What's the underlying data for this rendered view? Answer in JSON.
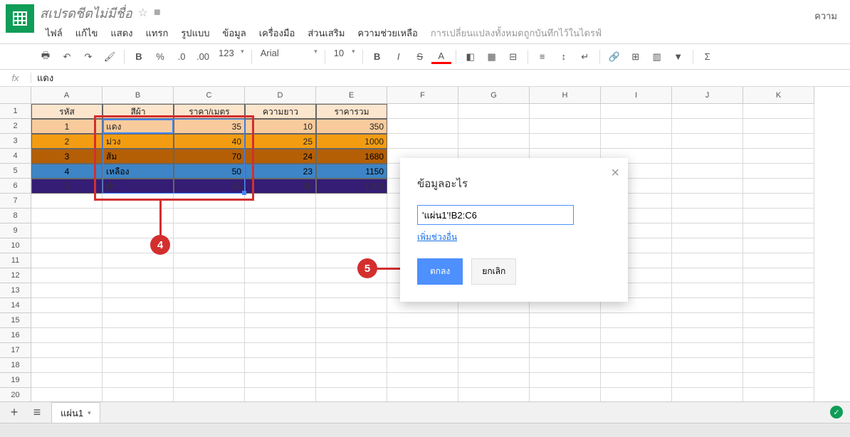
{
  "doc_title": "สเปรดชีตไม่มีชื่อ",
  "menus": [
    "ไฟล์",
    "แก้ไข",
    "แสดง",
    "แทรก",
    "รูปแบบ",
    "ข้อมูล",
    "เครื่องมือ",
    "ส่วนเสริม",
    "ความช่วยเหลือ"
  ],
  "save_status": "การเปลี่ยนแปลงทั้งหมดถูกบันทึกไว้ในไดรฟ์",
  "comments_btn": "ความ",
  "toolbar": {
    "font": "Arial",
    "size": "10",
    "more": "123",
    "bold": "B",
    "percent": "%",
    "dec1": ".0",
    "dec2": ".00"
  },
  "fx_label": "fx",
  "fx_value": "แดง",
  "columns": [
    "A",
    "B",
    "C",
    "D",
    "E",
    "F",
    "G",
    "H",
    "I",
    "J",
    "K"
  ],
  "rows": [
    "1",
    "2",
    "3",
    "4",
    "5",
    "6",
    "7",
    "8",
    "9",
    "10",
    "11",
    "12",
    "13",
    "14",
    "15",
    "16",
    "17",
    "18",
    "19",
    "20"
  ],
  "headers": [
    "รหัส",
    "สีผ้า",
    "ราคา/เมตร",
    "ความยาว",
    "ราคารวม"
  ],
  "data": [
    {
      "a": "1",
      "b": "แดง",
      "c": "35",
      "d": "10",
      "e": "350"
    },
    {
      "a": "2",
      "b": "ม่วง",
      "c": "40",
      "d": "25",
      "e": "1000"
    },
    {
      "a": "3",
      "b": "ส้ม",
      "c": "70",
      "d": "24",
      "e": "1680"
    },
    {
      "a": "4",
      "b": "เหลือง",
      "c": "50",
      "d": "23",
      "e": "1150"
    },
    {
      "a": "5",
      "b": "ดำ",
      "c": "45",
      "d": "30",
      "e": "1350"
    }
  ],
  "dialog": {
    "title": "ข้อมูลอะไร",
    "input_value": "'แผ่น1'!B2:C6",
    "link": "เพิ่มช่วงอื่น",
    "ok": "ตกลง",
    "cancel": "ยกเลิก"
  },
  "sheet_name": "แผ่น1",
  "annotations": {
    "box4": "4",
    "box5": "5"
  }
}
